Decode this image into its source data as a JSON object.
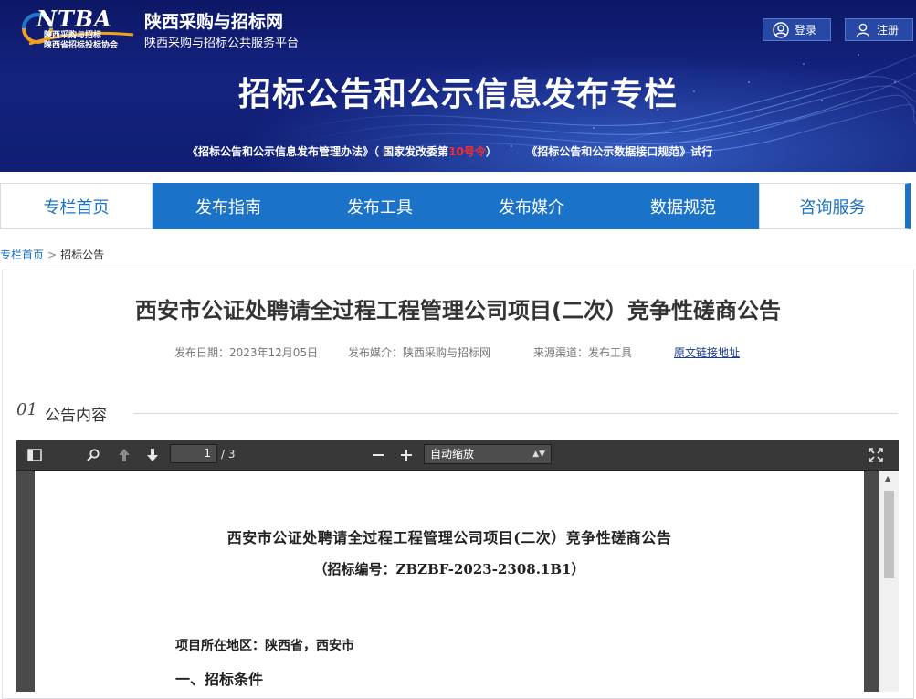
{
  "header": {
    "logo_text": "NTBA",
    "logo_sub1": "陕西采购与招标",
    "logo_sub2": "陕西省招标投标协会",
    "site_title": "陕西采购与招标网",
    "site_subtitle": "陕西采购与招标公共服务平台",
    "login_label": "登录",
    "register_label": "注册",
    "banner_title": "招标公告和公示信息发布专栏",
    "note_part1": "《招标公告和公示信息发布管理办法》（ 国家发改委第",
    "note_number": "10号令",
    "note_part2": "）",
    "note_part3": "《招标公告和公示数据接口规范》试行"
  },
  "nav": {
    "items": [
      {
        "label": "专栏首页"
      },
      {
        "label": "发布指南"
      },
      {
        "label": "发布工具"
      },
      {
        "label": "发布媒介"
      },
      {
        "label": "数据规范"
      },
      {
        "label": "咨询服务"
      }
    ]
  },
  "breadcrumb": {
    "home": "专栏首页",
    "separator": ">",
    "current": "招标公告"
  },
  "article": {
    "title": "西安市公证处聘请全过程工程管理公司项目(二次）竞争性磋商公告",
    "publish_date": "发布日期：2023年12月05日",
    "media": "发布媒介：陕西采购与招标网",
    "source": "来源渠道：发布工具",
    "original_link": "原文链接地址",
    "section_number": "01",
    "section_label": "公告内容"
  },
  "pdf_viewer": {
    "page_current": "1",
    "page_total": "/ 3",
    "zoom_value": "自动缩放",
    "doc_title": "西安市公证处聘请全过程工程管理公司项目(二次）竞争性磋商公告",
    "doc_code": "（招标编号：ZBZBF-2023-2308.1B1）",
    "doc_region": "项目所在地区：陕西省，西安市",
    "doc_section": "一、招标条件"
  },
  "colors": {
    "nav_blue": "#1a73c8",
    "banner_navy": "#14237e",
    "note_red": "#ff2a2a",
    "viewer_toolbar": "#383838"
  }
}
